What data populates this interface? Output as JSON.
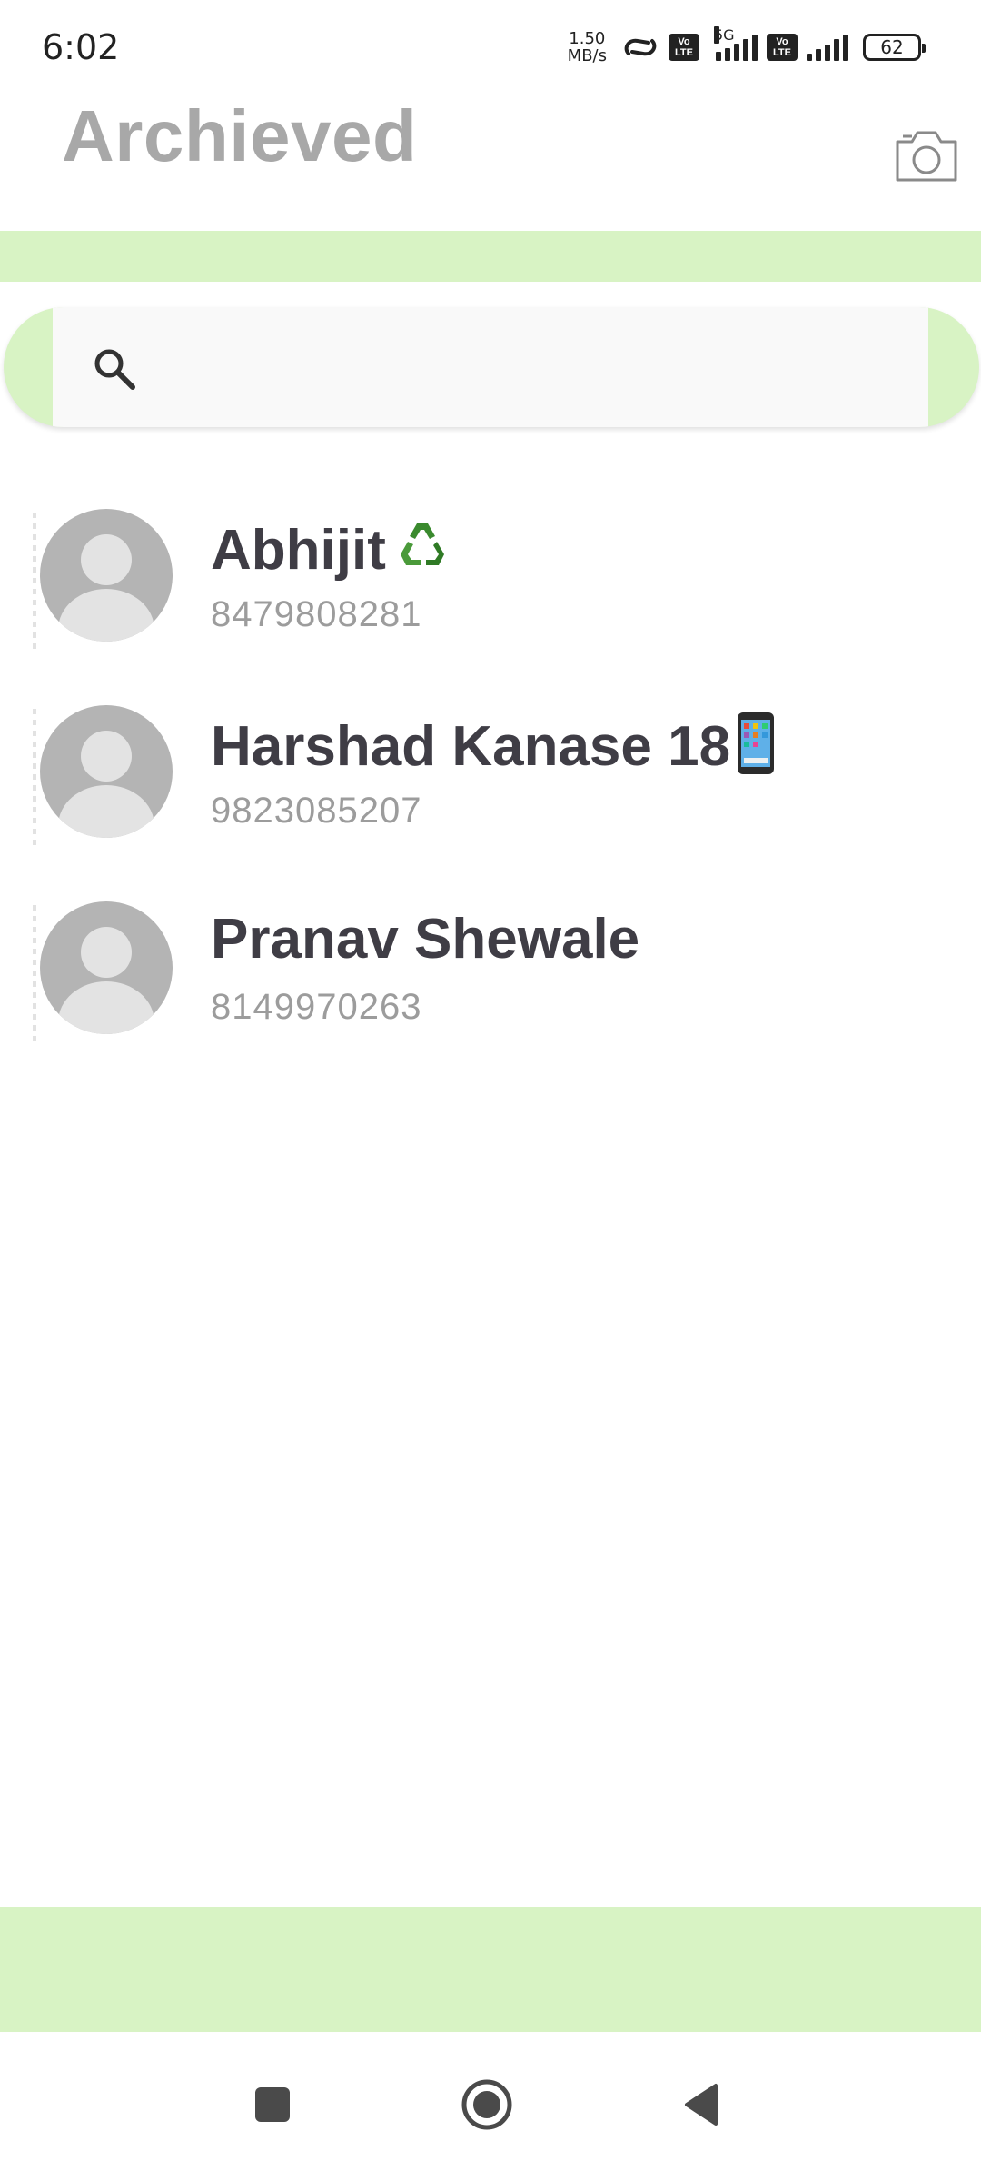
{
  "status_bar": {
    "time": "6:02",
    "net_speed_value": "1.50",
    "net_speed_unit": "MB/s",
    "network_gen": "5G",
    "volte_top": "Vo",
    "volte_bottom": "LTE",
    "battery": "62"
  },
  "header": {
    "title": "Archieved",
    "camera_icon": "camera-icon"
  },
  "search": {
    "placeholder": "",
    "value": "",
    "icon": "search-icon"
  },
  "contacts": [
    {
      "name": "Abhijit",
      "emoji": "recycle-emoji",
      "phone": "8479808281"
    },
    {
      "name": "Harshad Kanase 18",
      "emoji": "mobile-phone-emoji",
      "phone": "9823085207"
    },
    {
      "name": "Pranav Shewale",
      "emoji": "",
      "phone": "8149970263"
    }
  ],
  "colors": {
    "accent_green": "#d8f3c4",
    "title_gray": "#a8a8a8",
    "name_text": "#3f3d45",
    "phone_text": "#9c9c9c",
    "avatar_bg": "#b4b4b4"
  },
  "nav_bar": {
    "recent_icon": "square-icon",
    "home_icon": "circle-home-icon",
    "back_icon": "triangle-back-icon"
  }
}
